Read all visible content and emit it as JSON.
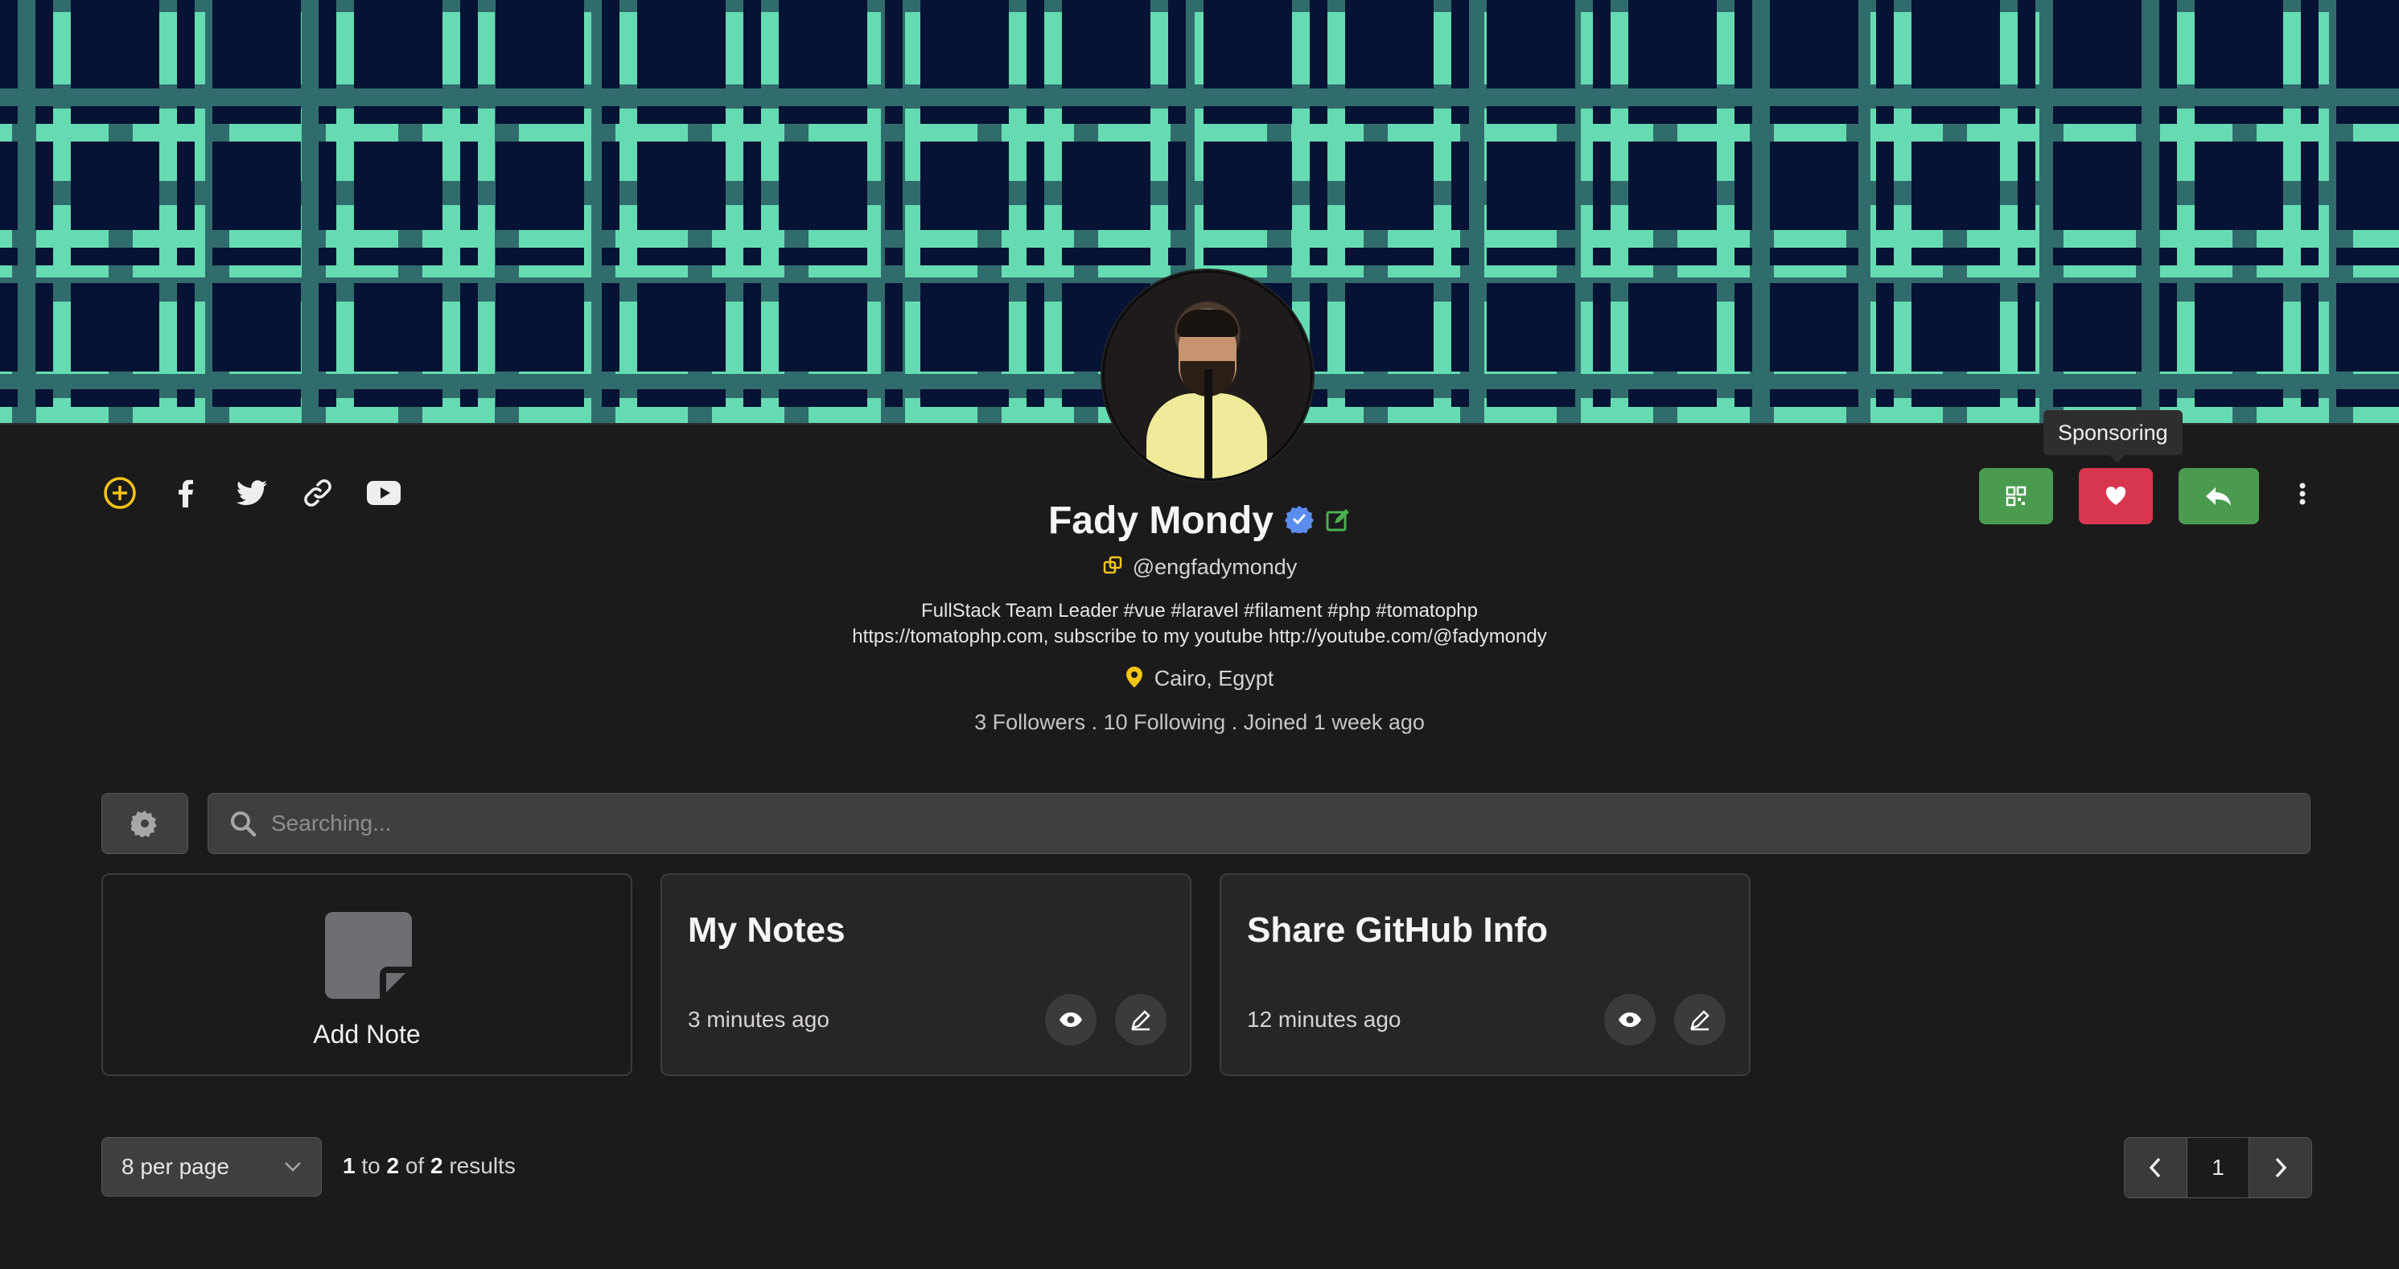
{
  "profile": {
    "name": "Fady Mondy",
    "handle": "@engfadymondy",
    "bio_line1": "FullStack Team Leader #vue #laravel #filament #php #tomatophp",
    "bio_line2": "https://tomatophp.com, subscribe to my youtube http://youtube.com/@fadymondy",
    "location": "Cairo, Egypt",
    "stats": "3 Followers . 10 Following . Joined 1 week ago"
  },
  "social_icons": [
    "plus-circle-icon",
    "facebook-icon",
    "twitter-icon",
    "link-icon",
    "youtube-icon"
  ],
  "actions": {
    "tooltip": "Sponsoring",
    "buttons": [
      {
        "name": "qr-code-button",
        "color": "#4a9b4f"
      },
      {
        "name": "sponsor-button",
        "color": "#d8354f"
      },
      {
        "name": "reply-button",
        "color": "#4a9b4f"
      }
    ]
  },
  "search": {
    "placeholder": "Searching..."
  },
  "notes": {
    "add_label": "Add Note",
    "items": [
      {
        "title": "My Notes",
        "time": "3 minutes ago"
      },
      {
        "title": "Share GitHub Info",
        "time": "12 minutes ago"
      }
    ]
  },
  "pagination": {
    "per_page": "8 per page",
    "from": "1",
    "to_word": "to",
    "to": "2",
    "of_word": "of",
    "total": "2",
    "results_word": "results",
    "current_page": "1"
  },
  "colors": {
    "accent_yellow": "#f5c518",
    "verified_blue": "#5b8def",
    "edit_green": "#4caf50",
    "cover_green": "#66dbb2",
    "cover_navy": "#061334"
  }
}
